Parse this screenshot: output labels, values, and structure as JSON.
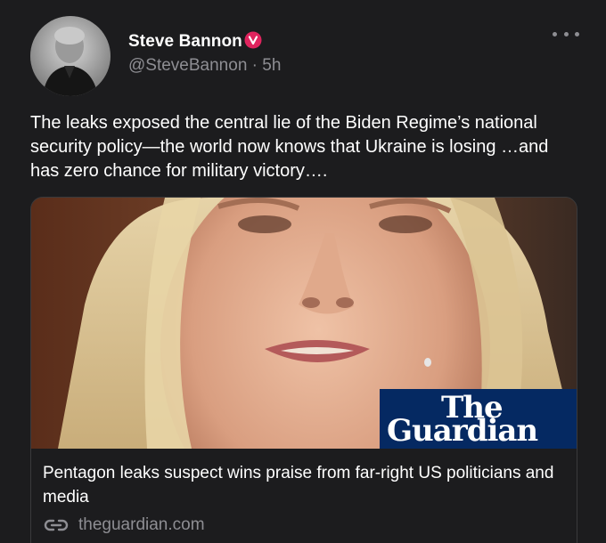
{
  "post": {
    "author_name": "Steve Bannon",
    "handle": "@SteveBannon",
    "separator": "·",
    "time_ago": "5h",
    "text": "The leaks exposed the central lie of the Biden Regime’s national security policy—the world now knows that Ukraine is losing …and has zero chance for military victory….",
    "avatar_icon": "profile-photo",
    "verified_icon": "verified-badge-icon",
    "more_icon": "more-options-icon"
  },
  "link_card": {
    "image_icon": "news-photo",
    "logo_line1": "The",
    "logo_line2": "Guardian",
    "title": "Pentagon leaks suspect wins praise from far-right US politicians and media",
    "domain": "theguardian.com",
    "domain_icon": "link-icon"
  },
  "colors": {
    "background": "#1c1c1e",
    "text_primary": "#ffffff",
    "text_secondary": "#8e8e93",
    "verified_badge": "#e0245e",
    "guardian_blue": "#052962",
    "card_border": "#3a3a3c"
  }
}
